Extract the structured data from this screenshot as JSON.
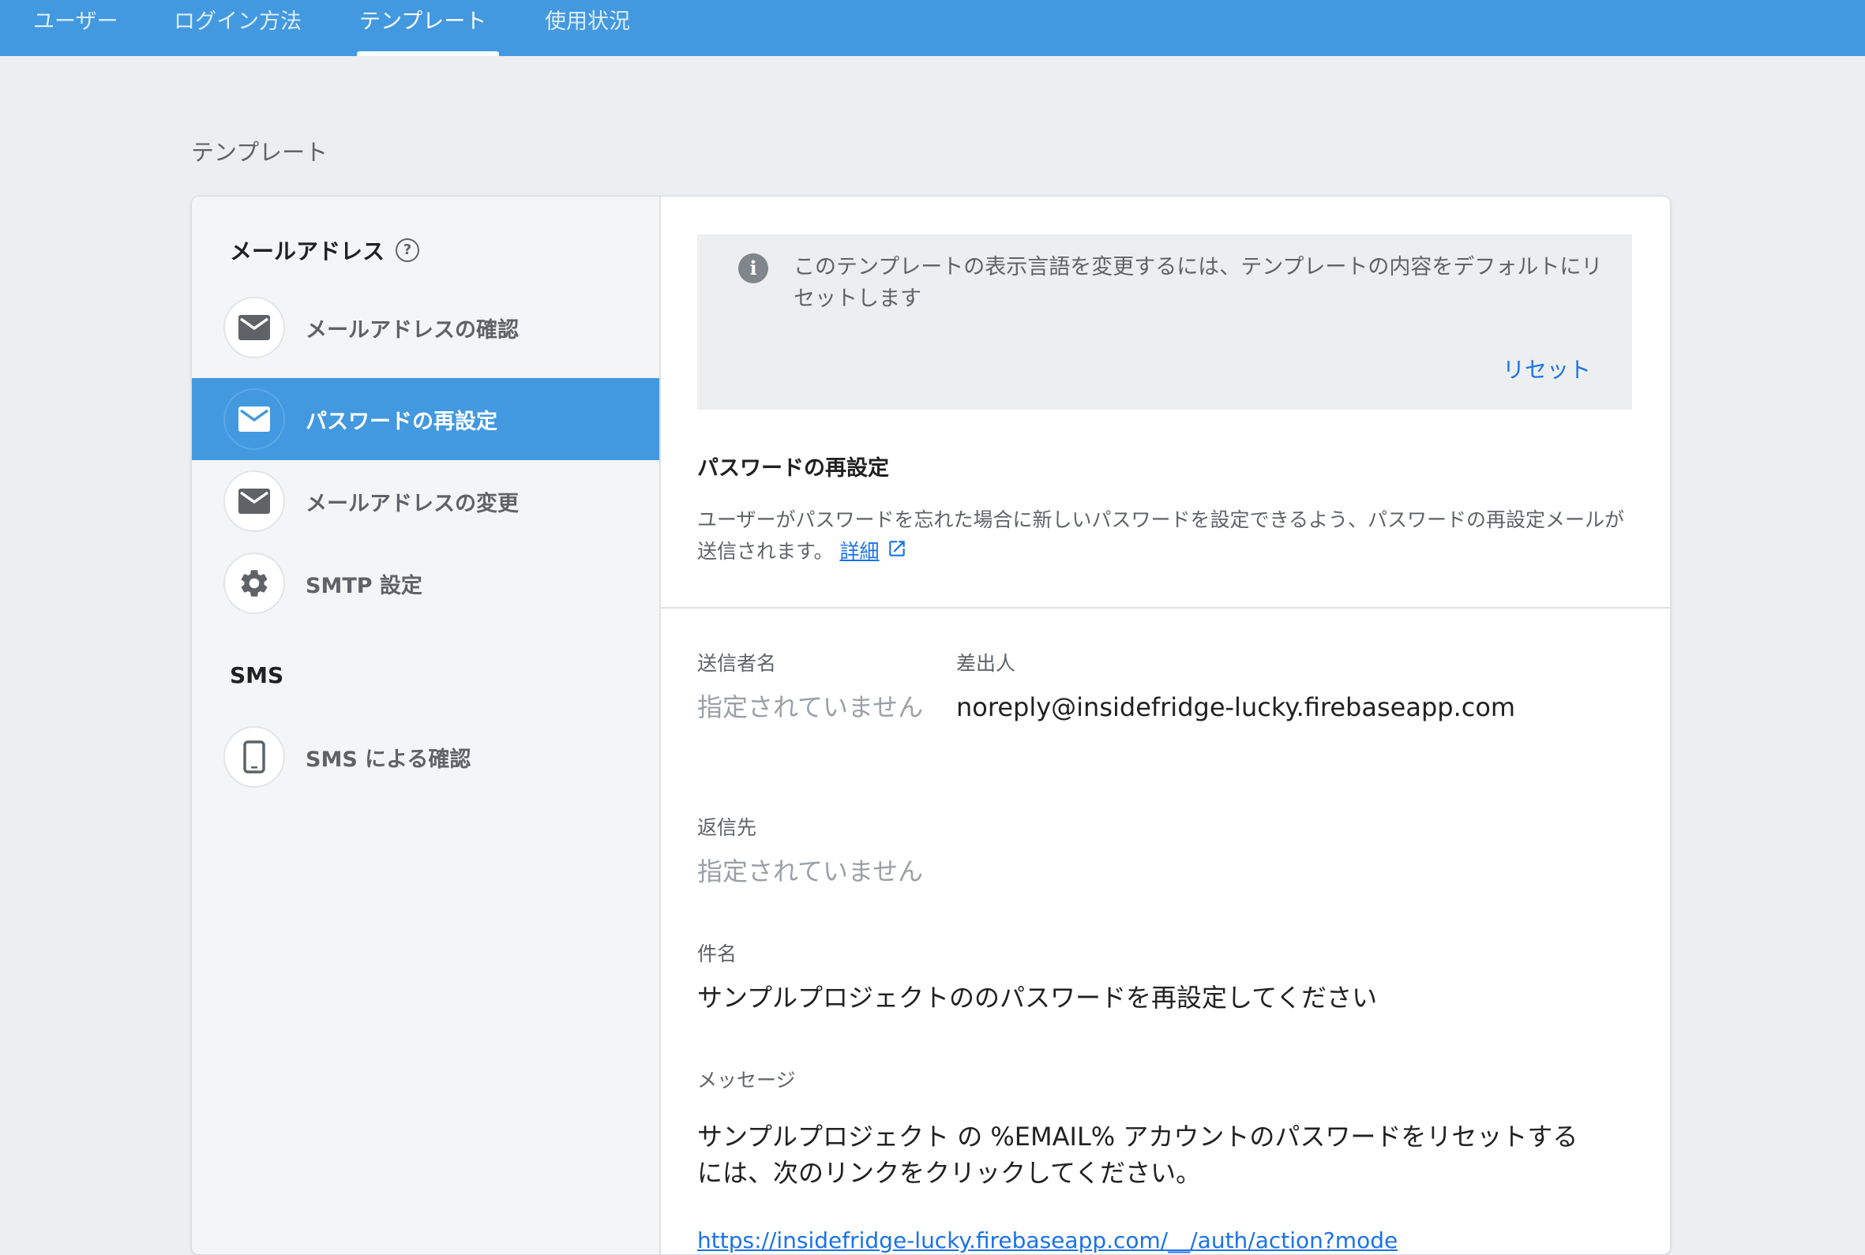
{
  "nav": {
    "tabs": [
      {
        "label": "ユーザー"
      },
      {
        "label": "ログイン方法"
      },
      {
        "label": "テンプレート"
      },
      {
        "label": "使用状況"
      }
    ],
    "active_tab": "テンプレート"
  },
  "page": {
    "title": "テンプレート"
  },
  "sidebar": {
    "email_group": {
      "title": "メールアドレス",
      "help_icon": "help-circle-icon"
    },
    "items": [
      {
        "label": "メールアドレスの確認",
        "icon": "mail-icon"
      },
      {
        "label": "パスワードの再設定",
        "icon": "mail-icon"
      },
      {
        "label": "メールアドレスの変更",
        "icon": "mail-icon"
      },
      {
        "label": "SMTP 設定",
        "icon": "gear-icon"
      }
    ],
    "sms_group": {
      "title": "SMS"
    },
    "sms_items": [
      {
        "label": "SMS による確認",
        "icon": "phone-icon"
      }
    ],
    "active_item": "パスワードの再設定"
  },
  "info": {
    "text": "このテンプレートの表示言語を変更するには、テンプレートの内容をデフォルトにリセットします",
    "reset_label": "リセット"
  },
  "template": {
    "title": "パスワードの再設定",
    "description": "ユーザーがパスワードを忘れた場合に新しいパスワードを設定できるよう、パスワードの再設定メールが送信されます。",
    "detail_link": "詳細"
  },
  "fields": {
    "sender_name_label": "送信者名",
    "sender_name_value": "指定されていません",
    "from_label": "差出人",
    "from_value": "noreply@insidefridge-lucky.firebaseapp.com",
    "reply_to_label": "返信先",
    "reply_to_value": "指定されていません",
    "subject_label": "件名",
    "subject_value": "サンプルプロジェクトののパスワードを再設定してください",
    "message_label": "メッセージ",
    "message_value": "サンプルプロジェクト の %EMAIL% アカウントのパスワードをリセットするには、次のリンクをクリックしてください。",
    "message_link": "https://insidefridge-lucky.firebaseapp.com/__/auth/action?mode"
  },
  "colors": {
    "primary": "#4299e0",
    "link": "#1a73e8",
    "background": "#eceef0"
  }
}
